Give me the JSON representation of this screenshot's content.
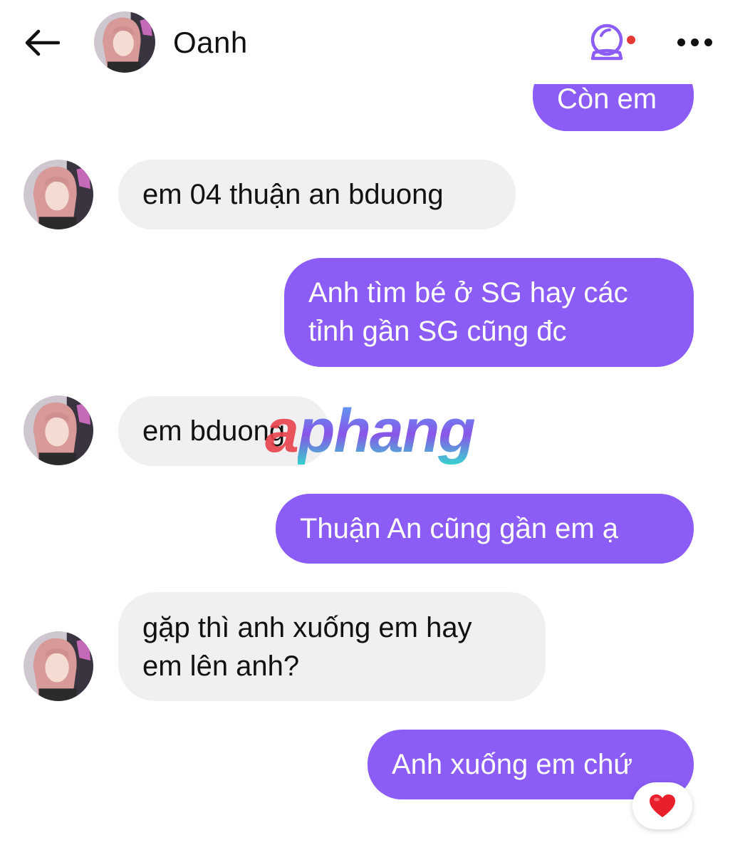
{
  "header": {
    "back_icon": "arrow-left-icon",
    "contact_name": "Oanh",
    "call_icon": "video-call-icon",
    "more_icon": "more-horizontal-icon",
    "accent_color": "#8b5cf6",
    "notification_dot_color": "#e53935"
  },
  "messages": [
    {
      "direction": "out",
      "text": "Còn em",
      "partial": true
    },
    {
      "direction": "in",
      "text": "em 04 thuận an bduong"
    },
    {
      "direction": "out",
      "lines": [
        "Anh tìm bé ở SG hay các",
        "tỉnh gần SG cũng đc"
      ]
    },
    {
      "direction": "in",
      "text": "em bduong"
    },
    {
      "direction": "out",
      "text": "Thuận An cũng gần em ạ"
    },
    {
      "direction": "in",
      "lines": [
        "gặp thì anh xuống em hay",
        "em lên anh?"
      ]
    },
    {
      "direction": "out",
      "text": "Anh xuống em chứ",
      "reaction": "❤️"
    }
  ],
  "watermark": {
    "first": "a",
    "rest": "phang"
  },
  "colors": {
    "incoming_bubble": "#f0f0f3",
    "outgoing_bubble": "#8b5cf6",
    "heart": "#e8202c"
  }
}
